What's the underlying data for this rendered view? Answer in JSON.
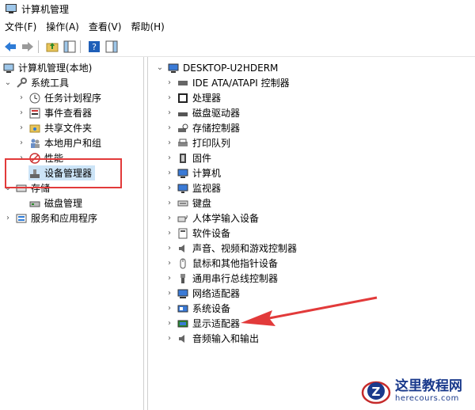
{
  "window": {
    "title": "计算机管理"
  },
  "menu": [
    {
      "label": "文件(F)"
    },
    {
      "label": "操作(A)"
    },
    {
      "label": "查看(V)"
    },
    {
      "label": "帮助(H)"
    }
  ],
  "left_tree": {
    "root": "计算机管理(本地)",
    "system_tools": "系统工具",
    "task_scheduler": "任务计划程序",
    "event_viewer": "事件查看器",
    "shared_folders": "共享文件夹",
    "local_users": "本地用户和组",
    "performance": "性能",
    "device_manager": "设备管理器",
    "storage": "存储",
    "disk_management": "磁盘管理",
    "services": "服务和应用程序"
  },
  "right_tree": {
    "root": "DESKTOP-U2HDERM",
    "items": [
      {
        "label": "IDE ATA/ATAPI 控制器"
      },
      {
        "label": "处理器"
      },
      {
        "label": "磁盘驱动器"
      },
      {
        "label": "存储控制器"
      },
      {
        "label": "打印队列"
      },
      {
        "label": "固件"
      },
      {
        "label": "计算机"
      },
      {
        "label": "监视器"
      },
      {
        "label": "键盘"
      },
      {
        "label": "人体学输入设备"
      },
      {
        "label": "软件设备"
      },
      {
        "label": "声音、视频和游戏控制器"
      },
      {
        "label": "鼠标和其他指针设备"
      },
      {
        "label": "通用串行总线控制器"
      },
      {
        "label": "网络适配器"
      },
      {
        "label": "系统设备"
      },
      {
        "label": "显示适配器"
      },
      {
        "label": "音频输入和输出"
      }
    ]
  },
  "watermark": {
    "name": "这里教程网",
    "url": "herecours.com"
  },
  "colors": {
    "highlight": "#e23a3a",
    "selection": "#cce4f7",
    "watermark": "#1a3a8c"
  }
}
